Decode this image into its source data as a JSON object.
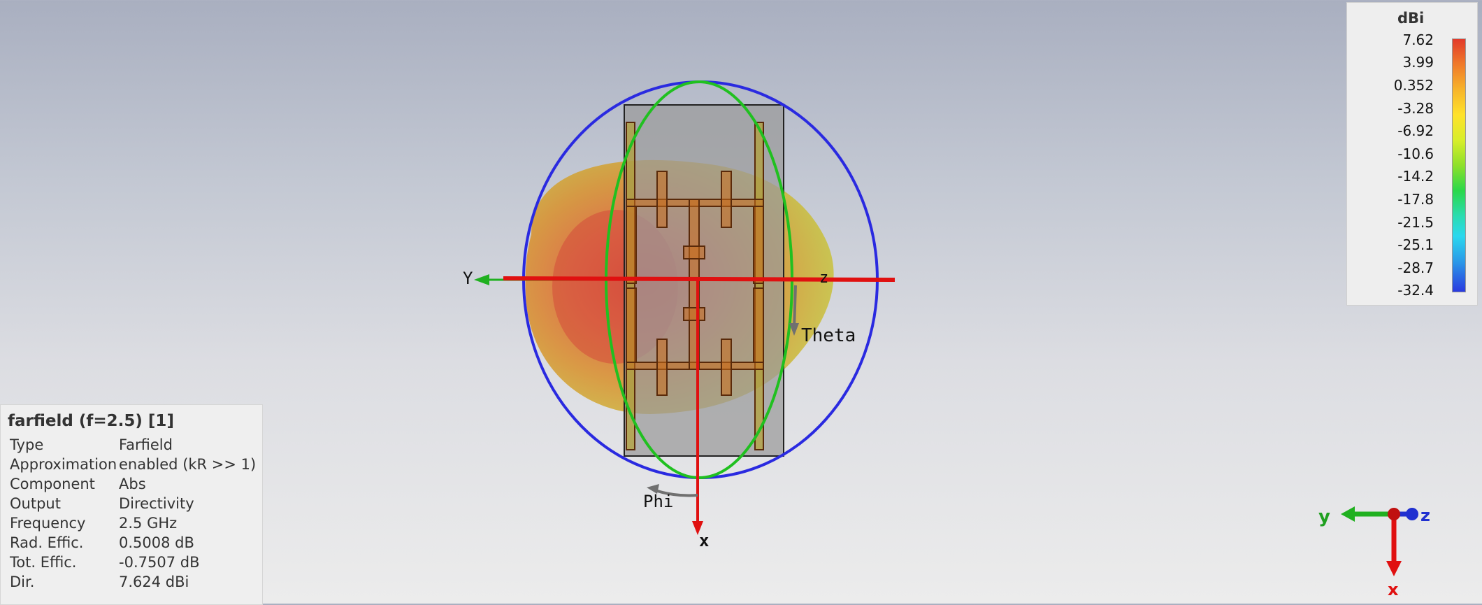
{
  "farfield": {
    "title": "farfield (f=2.5) [1]",
    "rows": [
      {
        "key": "Type",
        "value": "Farfield"
      },
      {
        "key": "Approximation",
        "value": "enabled (kR >> 1)"
      },
      {
        "key": "Component",
        "value": "Abs"
      },
      {
        "key": "Output",
        "value": "Directivity"
      },
      {
        "key": "Frequency",
        "value": "2.5 GHz"
      },
      {
        "key": "Rad. Effic.",
        "value": "0.5008 dB"
      },
      {
        "key": "Tot. Effic.",
        "value": "-0.7507 dB"
      },
      {
        "key": "Dir.",
        "value": "7.624 dBi"
      }
    ]
  },
  "legend": {
    "unit": "dBi",
    "ticks": [
      "7.62",
      "3.99",
      "0.352",
      "-3.28",
      "-6.92",
      "-10.6",
      "-14.2",
      "-17.8",
      "-21.5",
      "-25.1",
      "-28.7",
      "-32.4"
    ],
    "colors": [
      "#e23a2a",
      "#f07a2a",
      "#f7b42a",
      "#ffe22a",
      "#d8ee2a",
      "#8ee02a",
      "#2ad84a",
      "#2adcb0",
      "#2ad8ee",
      "#2a9ae8",
      "#2a3ae0"
    ]
  },
  "axes_labels": {
    "y": "Y",
    "z": "z",
    "x": "x",
    "theta": "Theta",
    "phi": "Phi"
  },
  "triad_labels": {
    "y": "y",
    "z": "z",
    "x": "x"
  },
  "colors": {
    "x_axis": "#e01010",
    "y_axis": "#20b020",
    "z_axis": "#2030d0",
    "theta_circle": "#20c020",
    "phi_circle": "#2a2ae0",
    "board": "#9a9a9a",
    "antenna": "#c86e1e"
  }
}
